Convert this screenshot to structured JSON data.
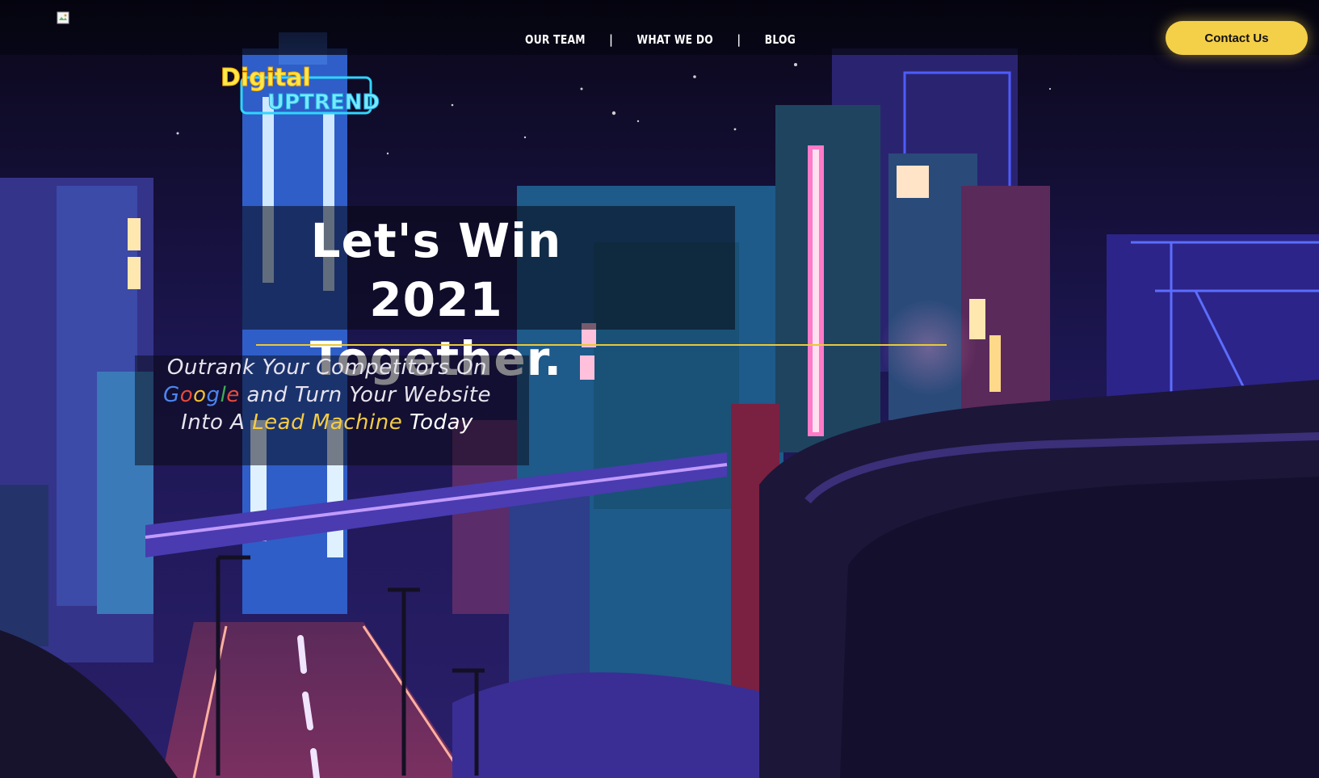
{
  "header": {
    "nav": [
      {
        "label": "OUR TEAM"
      },
      {
        "label": "WHAT WE DO"
      },
      {
        "label": "BLOG"
      }
    ],
    "separator": "|",
    "contact_label": "Contact Us"
  },
  "logo": {
    "line1": "Digital",
    "line2": "UPTREND"
  },
  "hero": {
    "title_line1": "Let's Win 2021",
    "title_line2": "Together.",
    "subtitle": {
      "line1": "Outrank Your Competitors On",
      "google": [
        "G",
        "o",
        "o",
        "g",
        "l",
        "e"
      ],
      "line2_rest": " and Turn Your Website",
      "line3_prefix": "Into A ",
      "line3_highlight": "Lead Machine",
      "line3_suffix": " Today"
    }
  },
  "colors": {
    "accent": "#f4cf48",
    "night_sky": "#0c0a1c",
    "neon_blue": "#3f7df5",
    "neon_pink": "#ff5fa8"
  }
}
